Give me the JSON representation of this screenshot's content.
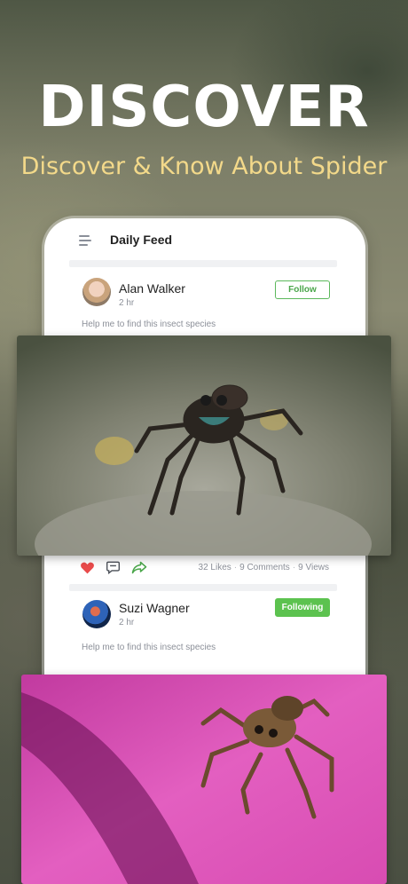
{
  "hero": {
    "title": "DISCOVER",
    "subtitle": "Discover & Know About Spider"
  },
  "app": {
    "header_title": "Daily Feed"
  },
  "posts": [
    {
      "user": "Alan Walker",
      "time": "2 hr",
      "text": "Help me to find this insect species",
      "button": "Follow",
      "likes": "32 Likes",
      "comments": "9 Comments",
      "views": "9 Views"
    },
    {
      "user": "Suzi Wagner",
      "time": "2 hr",
      "text": "Help me to find this insect species",
      "button": "Following"
    }
  ],
  "colors": {
    "accent_green": "#5cc24f",
    "heart_red": "#e94b4b",
    "subtitle_gold": "#f3d98a"
  },
  "icons": [
    "menu-icon",
    "heart-icon",
    "comment-icon",
    "share-icon"
  ]
}
